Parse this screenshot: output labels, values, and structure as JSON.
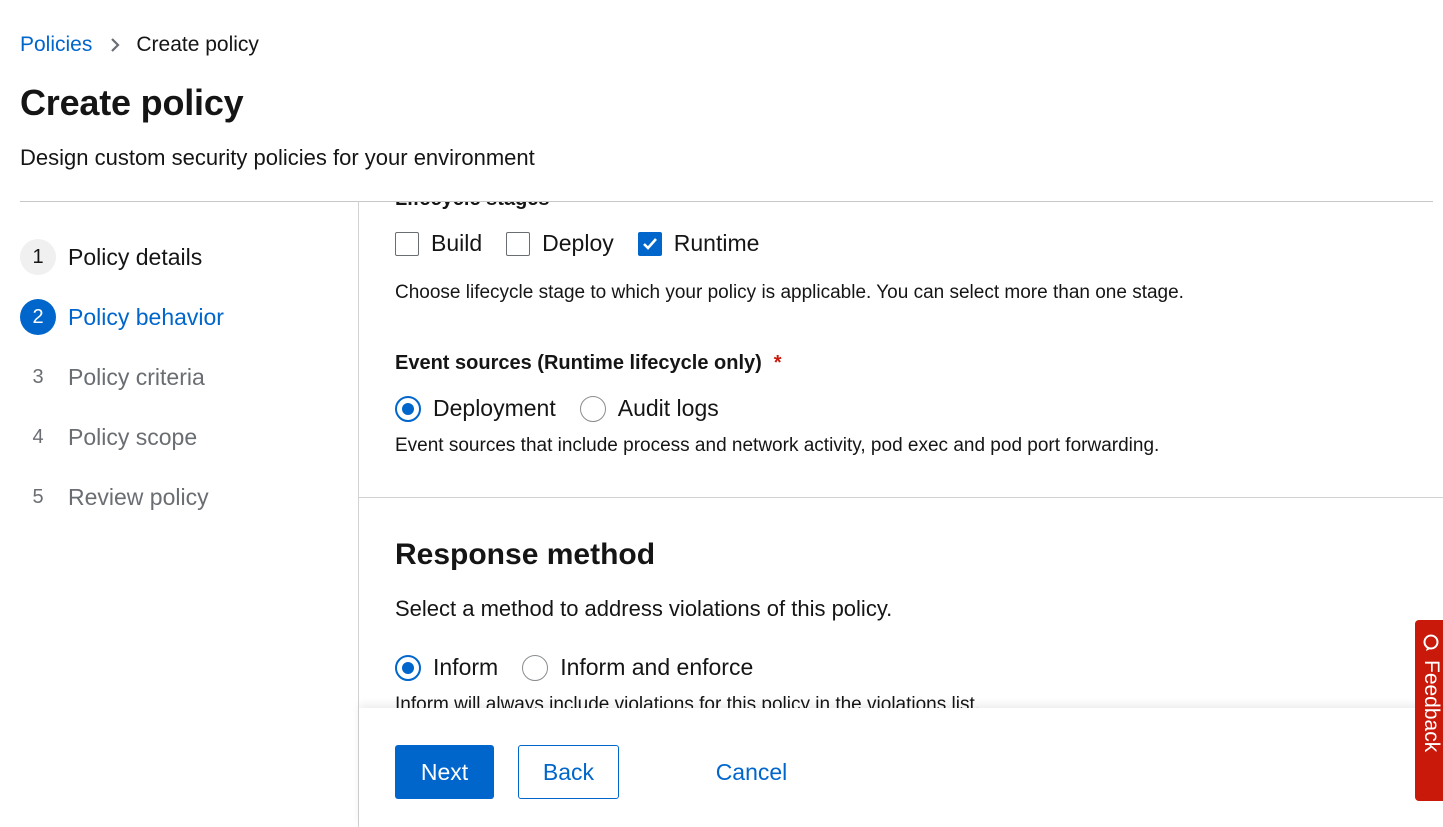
{
  "breadcrumb": {
    "parent": "Policies",
    "current": "Create policy"
  },
  "header": {
    "title": "Create policy",
    "description": "Design custom security policies for your environment"
  },
  "wizard": {
    "steps": [
      {
        "number": "1",
        "label": "Policy details",
        "state": "done"
      },
      {
        "number": "2",
        "label": "Policy behavior",
        "state": "current"
      },
      {
        "number": "3",
        "label": "Policy criteria",
        "state": "pending"
      },
      {
        "number": "4",
        "label": "Policy scope",
        "state": "pending"
      },
      {
        "number": "5",
        "label": "Review policy",
        "state": "pending"
      }
    ]
  },
  "lifecycle": {
    "label": "Lifecycle stages",
    "options": [
      {
        "label": "Build",
        "checked": false
      },
      {
        "label": "Deploy",
        "checked": false
      },
      {
        "label": "Runtime",
        "checked": true
      }
    ],
    "helper": "Choose lifecycle stage to which your policy is applicable. You can select more than one stage."
  },
  "event_sources": {
    "label": "Event sources (Runtime lifecycle only)",
    "required_mark": "*",
    "options": [
      {
        "label": "Deployment",
        "selected": true
      },
      {
        "label": "Audit logs",
        "selected": false
      }
    ],
    "helper": "Event sources that include process and network activity, pod exec and pod port forwarding."
  },
  "response_method": {
    "title": "Response method",
    "description": "Select a method to address violations of this policy.",
    "options": [
      {
        "label": "Inform",
        "selected": true
      },
      {
        "label": "Inform and enforce",
        "selected": false
      }
    ],
    "helper": "Inform will always include violations for this policy in the violations list."
  },
  "footer": {
    "next_label": "Next",
    "back_label": "Back",
    "cancel_label": "Cancel"
  },
  "feedback": {
    "label": "Feedback"
  },
  "colors": {
    "accent": "#0066cc",
    "required": "#c9190b",
    "feedback_bg": "#c9190b",
    "divider": "#d2d2d2"
  }
}
